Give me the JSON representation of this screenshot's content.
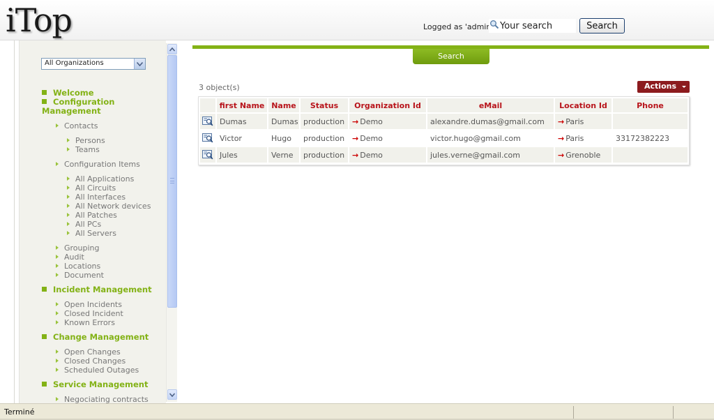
{
  "header": {
    "logo": "iTop",
    "logged_as": "Logged as 'admin'",
    "search_placeholder": "Your search",
    "search_button": "Search"
  },
  "sidebar": {
    "org_selected": "All Organizations",
    "welcome": "Welcome",
    "config_mgmt_line1": "Configuration",
    "config_mgmt_line2": "Management",
    "contacts": "Contacts",
    "persons": "Persons",
    "teams": "Teams",
    "config_items": "Configuration Items",
    "all_applications": "All Applications",
    "all_circuits": "All Circuits",
    "all_interfaces": "All Interfaces",
    "all_network_devices": "All Network devices",
    "all_patches": "All Patches",
    "all_pcs": "All PCs",
    "all_servers": "All Servers",
    "grouping": "Grouping",
    "audit": "Audit",
    "locations": "Locations",
    "document": "Document",
    "incident_mgmt": "Incident Management",
    "open_incidents": "Open Incidents",
    "closed_incident": "Closed Incident",
    "known_errors": "Known Errors",
    "change_mgmt": "Change Management",
    "open_changes": "Open Changes",
    "closed_changes": "Closed Changes",
    "scheduled_outages": "Scheduled Outages",
    "service_mgmt": "Service Management",
    "negociating_contracts": "Negociating contracts"
  },
  "main": {
    "search_tab": "Search",
    "object_count": "3 object(s)",
    "actions_button": "Actions",
    "columns": [
      "first Name",
      "Name",
      "Status",
      "Organization Id",
      "eMail",
      "Location Id",
      "Phone"
    ],
    "rows": [
      {
        "first_name": "Dumas",
        "name": "Dumas",
        "status": "production",
        "org": "Demo",
        "email": "alexandre.dumas@gmail.com",
        "location": "Paris",
        "phone": ""
      },
      {
        "first_name": "Victor",
        "name": "Hugo",
        "status": "production",
        "org": "Demo",
        "email": "victor.hugo@gmail.com",
        "location": "Paris",
        "phone": "33172382223"
      },
      {
        "first_name": "Jules",
        "name": "Verne",
        "status": "production",
        "org": "Demo",
        "email": "jules.verne@gmail.com",
        "location": "Grenoble",
        "phone": ""
      }
    ]
  },
  "statusbar": {
    "text": "Terminé"
  },
  "colors": {
    "accent_green": "#83b216",
    "header_red": "#b8141b",
    "actions_red": "#8c1b1e"
  }
}
